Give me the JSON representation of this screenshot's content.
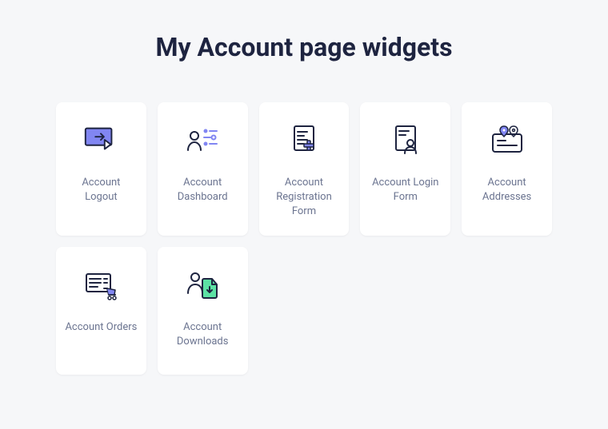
{
  "title": "My Account page widgets",
  "colors": {
    "stroke": "#1e2440",
    "purple": "#8186f2",
    "green": "#5ce2a4",
    "text": "#6b7490"
  },
  "widgets": [
    {
      "label": "Account Logout",
      "icon": "logout-icon"
    },
    {
      "label": "Account Dashboard",
      "icon": "dashboard-icon"
    },
    {
      "label": "Account Registration Form",
      "icon": "registration-form-icon"
    },
    {
      "label": "Account Login Form",
      "icon": "login-form-icon"
    },
    {
      "label": "Account Addresses",
      "icon": "addresses-icon"
    },
    {
      "label": "Account Orders",
      "icon": "orders-icon"
    },
    {
      "label": "Account Downloads",
      "icon": "downloads-icon"
    }
  ]
}
